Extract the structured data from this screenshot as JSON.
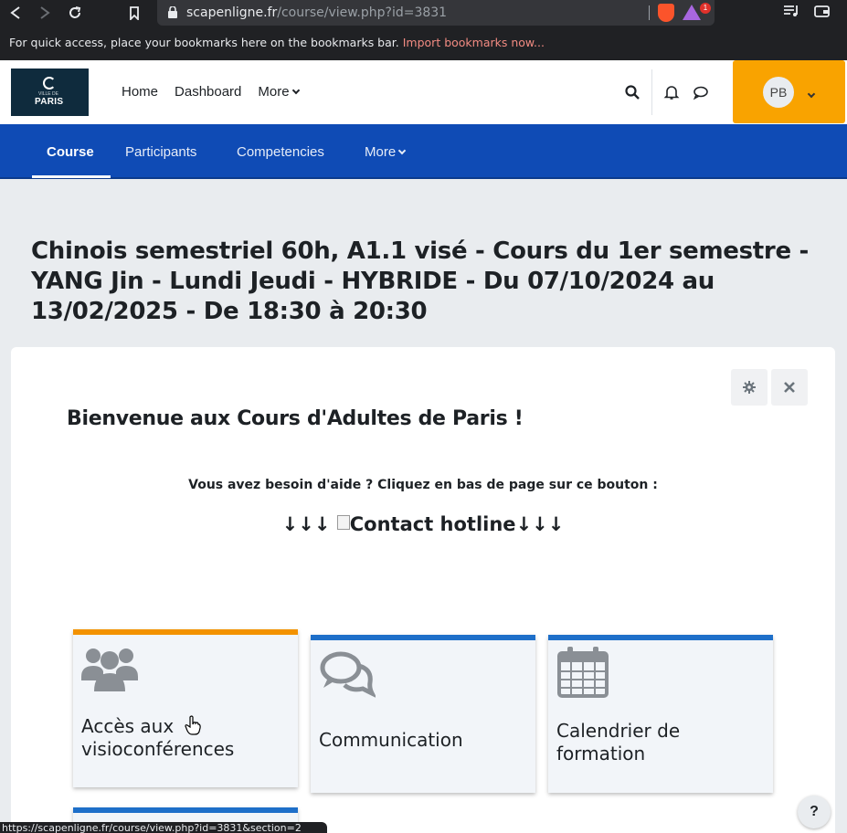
{
  "browser": {
    "url_host": "scapenligne.fr",
    "url_path": "/course/view.php?id=3831",
    "bookmarks_prompt": "For quick access, place your bookmarks here on the bookmarks bar.",
    "bookmarks_link": "Import bookmarks now...",
    "rewards_badge": "1",
    "status_url": "https://scapenligne.fr/course/view.php?id=3831&section=2"
  },
  "header": {
    "logo_text": "PARIS",
    "logo_small": "VILLE DE",
    "nav": [
      "Home",
      "Dashboard",
      "More"
    ],
    "user_initials": "PB",
    "accent": "#f9a300"
  },
  "secondary_nav": {
    "items": [
      "Course",
      "Participants",
      "Competencies",
      "More"
    ],
    "active": "Course",
    "color": "#0f4bb5"
  },
  "page": {
    "title": "Chinois semestriel 60h, A1.1 visé - Cours du 1er semestre - YANG Jin - Lundi Jeudi - HYBRIDE - Du 07/10/2024 au 13/02/2025 - De 18:30 à 20:30",
    "welcome": "Bienvenue aux Cours d'Adultes de Paris !",
    "help_text": "Vous avez besoin d'aide ? Cliquez en bas de page sur ce bouton :",
    "hotline_arrows_left": "↓↓↓",
    "hotline_text": "Contact hotline",
    "hotline_arrows_right": "↓↓↓"
  },
  "tiles": [
    {
      "label": "Accès aux visioconférences",
      "icon": "users-icon",
      "bar_color": "#f39200"
    },
    {
      "label": "Communication",
      "icon": "comments-icon",
      "bar_color": "#1e6fc9"
    },
    {
      "label": "Calendrier de formation",
      "icon": "calendar-icon",
      "bar_color": "#1e6fc9"
    }
  ],
  "help_fab": "?"
}
